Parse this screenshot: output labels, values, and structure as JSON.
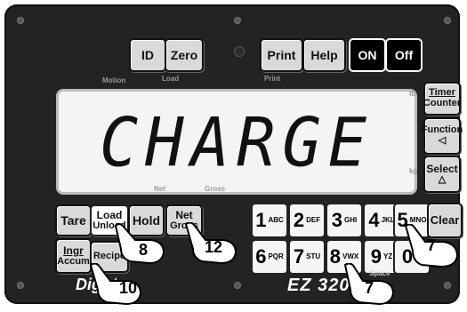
{
  "top_buttons": {
    "id": "ID",
    "zero": "Zero",
    "print": "Print",
    "help": "Help",
    "on": "ON",
    "off": "Off"
  },
  "indicators": {
    "motion": "Motion",
    "load": "Load",
    "print": "Print",
    "net": "Net",
    "gross": "Gross",
    "lb": "lb",
    "kg": "kg"
  },
  "display": {
    "text": "CHARGE"
  },
  "side_buttons": {
    "timer_line1": "Timer",
    "timer_line2": "Counter",
    "function": "Function",
    "select": "Select"
  },
  "left_buttons": {
    "tare": "Tare",
    "load_line1": "Load",
    "load_line2": "Unload",
    "hold": "Hold",
    "net_line1": "Net",
    "net_line2": "Gross",
    "ingr_line1": "Ingr",
    "ingr_line2": "Accum",
    "recipe": "Recipe"
  },
  "keypad": [
    {
      "num": "1",
      "sub": "ABC"
    },
    {
      "num": "2",
      "sub": "DEF"
    },
    {
      "num": "3",
      "sub": "GHI"
    },
    {
      "num": "4",
      "sub": "JKL"
    },
    {
      "num": "5",
      "sub": "MNO"
    },
    {
      "num": "6",
      "sub": "PQR"
    },
    {
      "num": "7",
      "sub": "STU"
    },
    {
      "num": "8",
      "sub": "VWX"
    },
    {
      "num": "9",
      "sub": "YZ"
    },
    {
      "num": "0",
      "sub": "-.*"
    }
  ],
  "keypad_extra": {
    "clear": "Clear",
    "space": "Space"
  },
  "brand": {
    "left": "Dig",
    "model": "EZ 320"
  },
  "callouts": {
    "c8": "8",
    "c12": "12",
    "c7a": "7",
    "c10": "10",
    "c7b": "7"
  }
}
